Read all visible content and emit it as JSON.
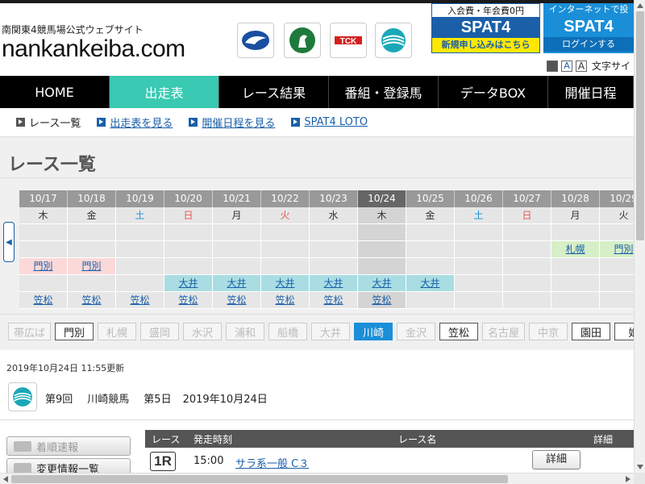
{
  "header": {
    "sub_title": "南関東4競馬場公式ウェブサイト",
    "logo": "nankankeiba.com",
    "emblems": [
      "urawa-emblem",
      "funabashi-emblem",
      "tck-emblem",
      "kawasaki-emblem"
    ]
  },
  "promos": {
    "a": {
      "line1": "入会費・年会費0円",
      "line2": "SPAT4",
      "line3": "新規申し込みはこちら"
    },
    "b": {
      "line1": "インターネットで投",
      "line2": "SPAT4",
      "line3": "ログインする"
    }
  },
  "font_size": {
    "label": "文字サイ"
  },
  "global_nav": [
    {
      "label": "HOME"
    },
    {
      "label": "出走表"
    },
    {
      "label": "レース結果"
    },
    {
      "label": "番組・登録馬"
    },
    {
      "label": "データBOX"
    },
    {
      "label": "開催日程"
    }
  ],
  "sub_nav": [
    {
      "label": "レース一覧"
    },
    {
      "label": "出走表を見る"
    },
    {
      "label": "開催日程を見る"
    },
    {
      "label": "SPAT4 LOTO"
    }
  ],
  "page_title": "レース一覧",
  "calendar": {
    "dates": [
      "10/17",
      "10/18",
      "10/19",
      "10/20",
      "10/21",
      "10/22",
      "10/23",
      "10/24",
      "10/25",
      "10/26",
      "10/27",
      "10/28",
      "10/29"
    ],
    "weekdays": [
      "木",
      "金",
      "土",
      "日",
      "月",
      "火",
      "水",
      "木",
      "金",
      "土",
      "日",
      "月",
      "火"
    ],
    "rows": [
      [
        "",
        "",
        "",
        "",
        "",
        "",
        "",
        "",
        "",
        "",
        "",
        "",
        ""
      ],
      [
        "",
        "",
        "",
        "",
        "",
        "",
        "",
        "",
        "",
        "",
        "",
        "札幌",
        "門別"
      ],
      [
        "門別",
        "門別",
        "",
        "",
        "",
        "",
        "",
        "",
        "",
        "",
        "",
        "",
        ""
      ],
      [
        "",
        "",
        "",
        "大井",
        "大井",
        "大井",
        "大井",
        "大井",
        "大井",
        "",
        "",
        "",
        ""
      ],
      [
        "笠松",
        "笠松",
        "笠松",
        "笠松",
        "笠松",
        "笠松",
        "笠松",
        "笠松",
        "",
        "",
        "",
        "",
        ""
      ]
    ]
  },
  "tracks": [
    "帯広ば",
    "門別",
    "札幌",
    "盛岡",
    "水沢",
    "浦和",
    "船橋",
    "大井",
    "川崎",
    "金沢",
    "笠松",
    "名古屋",
    "中京",
    "園田",
    "姫"
  ],
  "updated": "2019年10月24日 11:55更新",
  "meeting": {
    "kai": "第9回",
    "venue": "川崎競馬",
    "day": "第5日",
    "date": "2019年10月24日"
  },
  "side_buttons": {
    "b1": "着順速報",
    "b2": "変更情報一覧"
  },
  "race_table": {
    "headers": [
      "レース",
      "発走時刻",
      "レース名",
      "詳細"
    ],
    "rows": [
      {
        "no": "1R",
        "time": "15:00",
        "name": "サラ系一般 C３",
        "detail": "詳細"
      }
    ]
  }
}
